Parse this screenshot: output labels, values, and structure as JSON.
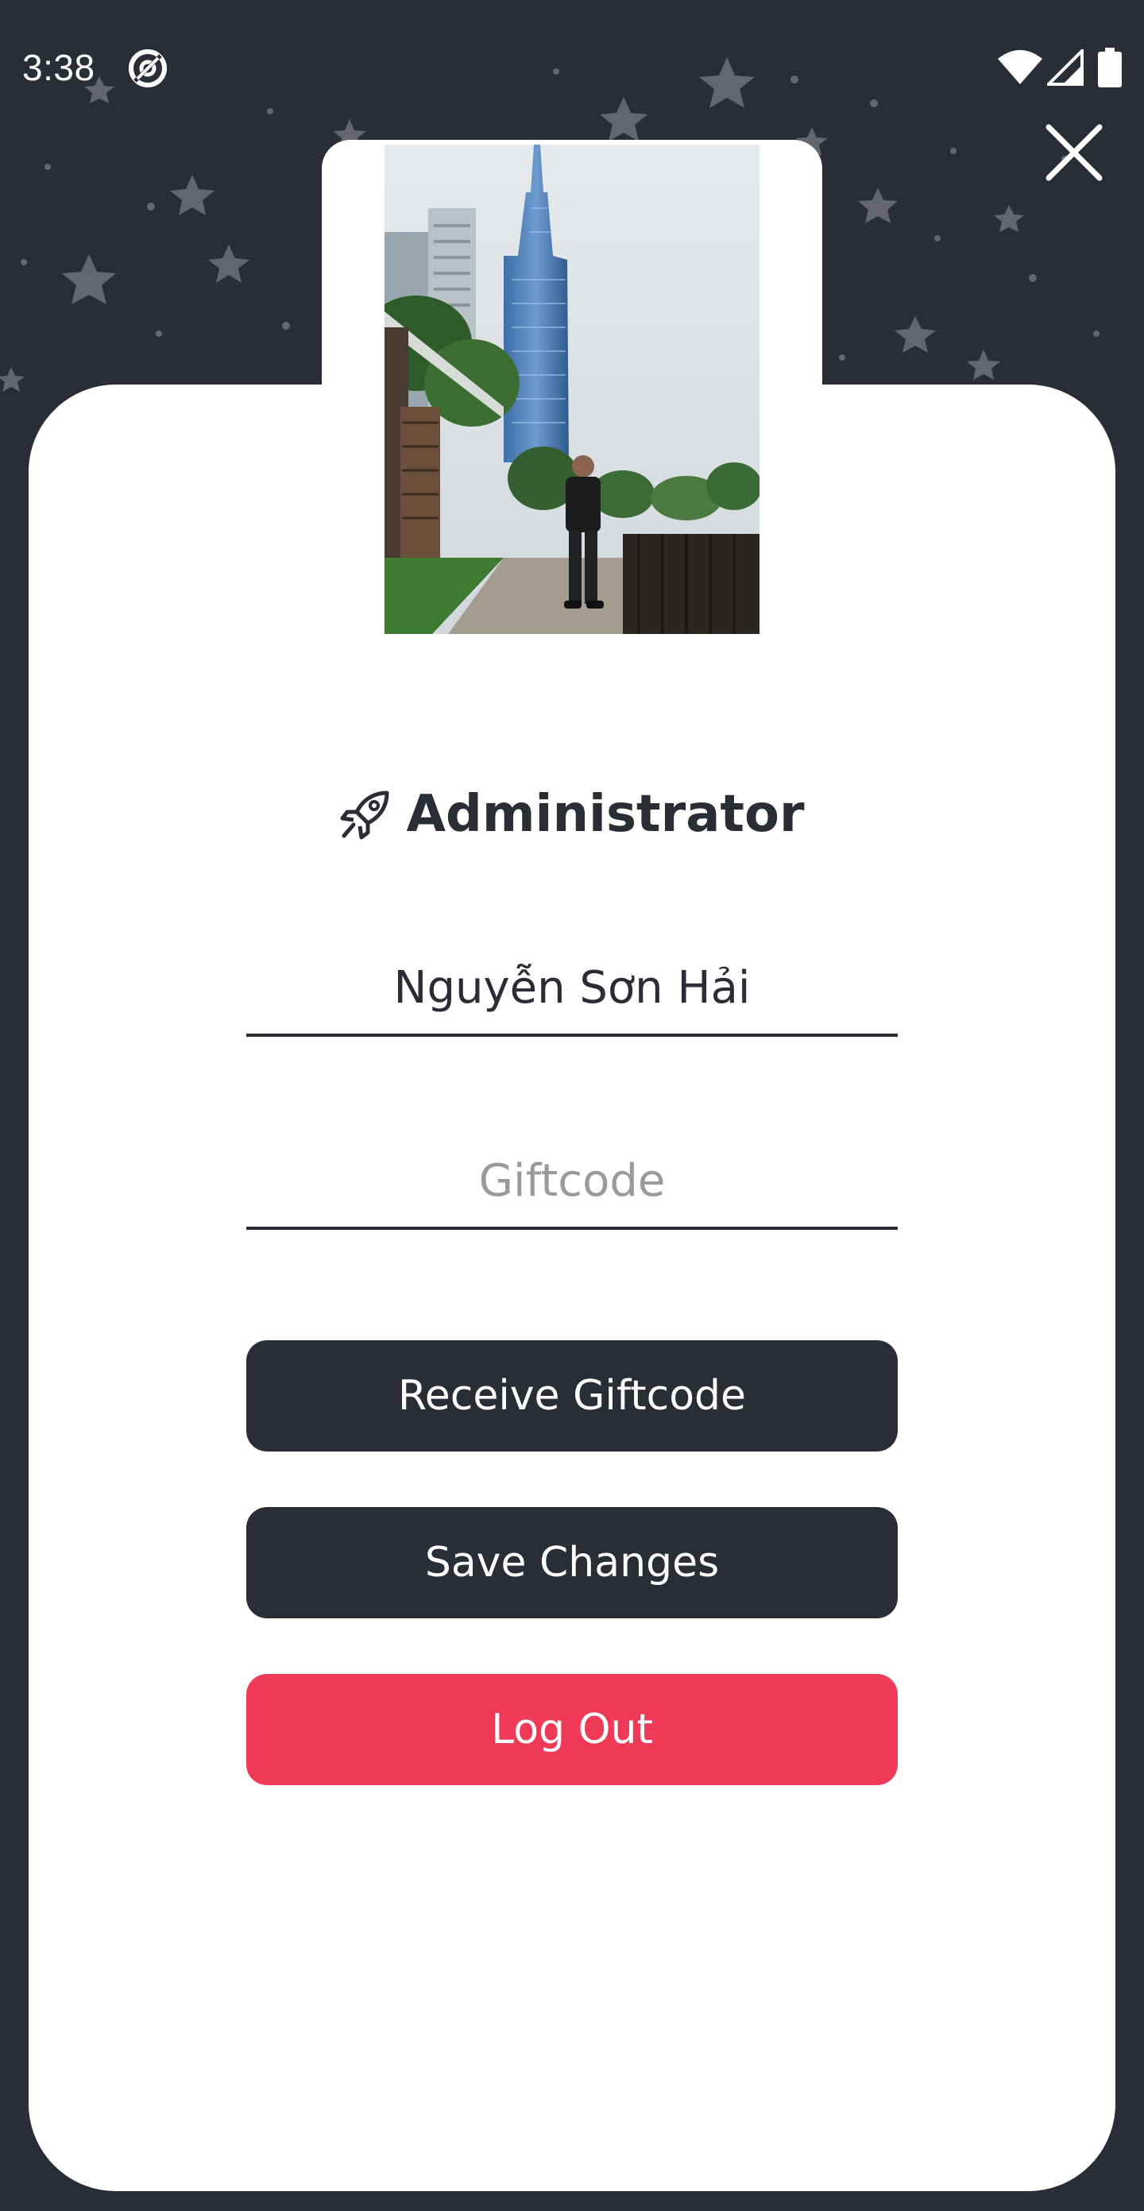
{
  "status_bar": {
    "time": "3:38",
    "app_icon": "sync-app-icon",
    "wifi_icon": "wifi-icon",
    "signal_icon": "cell-signal-icon",
    "battery_icon": "battery-icon"
  },
  "header": {
    "close_icon": "close-icon"
  },
  "profile": {
    "avatar_alt": "avatar",
    "role_icon": "rocket-icon",
    "role": "Administrator",
    "name_value": "Nguyễn Sơn Hải",
    "giftcode_placeholder": "Giftcode",
    "giftcode_value": ""
  },
  "actions": {
    "receive_label": "Receive Giftcode",
    "save_label": "Save Changes",
    "logout_label": "Log Out"
  },
  "colors": {
    "background": "#2a2d35",
    "card": "#ffffff",
    "primary_button": "#2a2d35",
    "logout_button": "#ee3a57",
    "star": "#6e7078"
  }
}
